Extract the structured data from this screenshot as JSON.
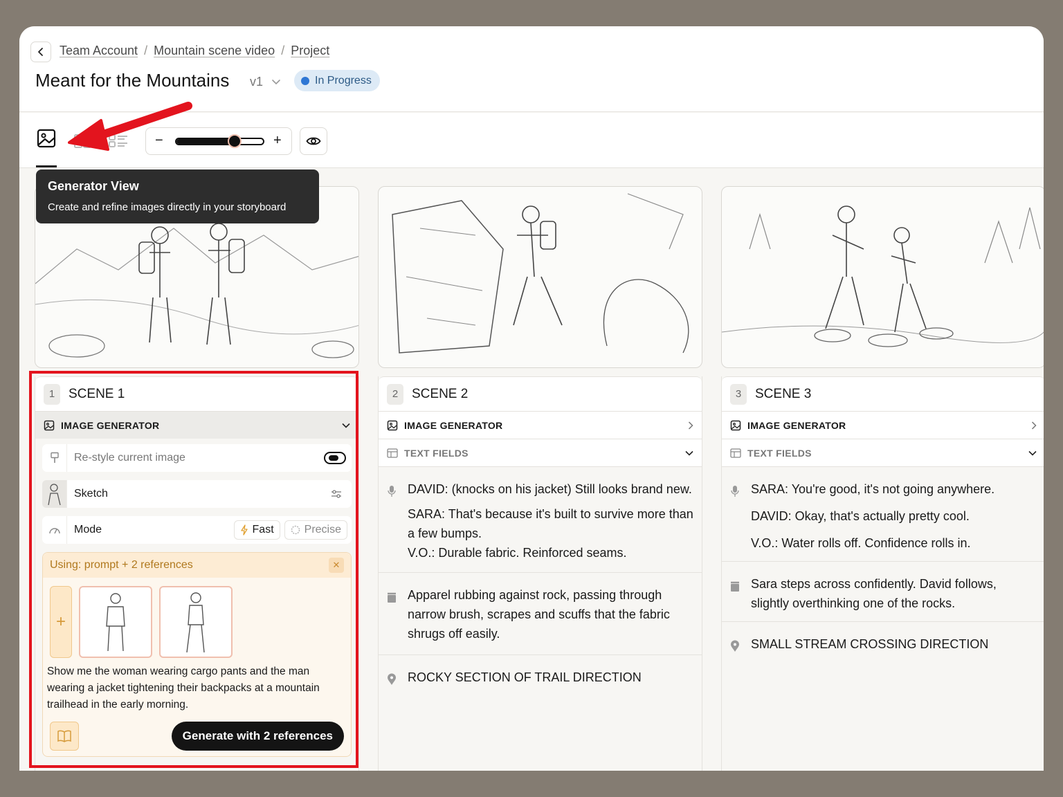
{
  "breadcrumbs": [
    "Team Account",
    "Mountain scene video",
    "Project"
  ],
  "project": {
    "title": "Meant for the Mountains",
    "version": "v1",
    "status": "In Progress"
  },
  "toolbar": {
    "zoom_level": 0.67
  },
  "tooltip": {
    "title": "Generator View",
    "description": "Create and refine images directly in your storyboard"
  },
  "sections": {
    "image_generator": "IMAGE GENERATOR",
    "text_fields": "TEXT FIELDS"
  },
  "scenes": [
    {
      "number": "1",
      "title": "SCENE 1",
      "generator": {
        "restyle_placeholder": "Re-style current image",
        "style": "Sketch",
        "mode_label": "Mode",
        "mode_options": [
          "Fast",
          "Precise"
        ],
        "using_label": "Using: prompt + 2 references",
        "prompt": "Show me the woman wearing cargo pants and the man wearing a jacket tightening their backpacks at a mountain trailhead in the early morning.",
        "generate_label": "Generate with 2 references"
      }
    },
    {
      "number": "2",
      "title": "SCENE 2",
      "dialogue": [
        "DAVID: (knocks on his jacket) Still looks brand new.",
        "SARA: That's because it's built to survive more than a few bumps.",
        "V.O.: Durable fabric. Reinforced seams."
      ],
      "action": "Apparel rubbing against rock, passing through narrow brush, scrapes and scuffs that the fabric shrugs off easily.",
      "location": "ROCKY SECTION OF TRAIL DIRECTION"
    },
    {
      "number": "3",
      "title": "SCENE 3",
      "dialogue": [
        "SARA: You're good, it's not going anywhere.",
        "DAVID: Okay, that's actually pretty cool.",
        "V.O.: Water rolls off. Confidence rolls in."
      ],
      "action": "Sara steps across confidently. David follows, slightly overthinking one of the rocks.",
      "location": "SMALL STREAM CROSSING DIRECTION"
    }
  ]
}
